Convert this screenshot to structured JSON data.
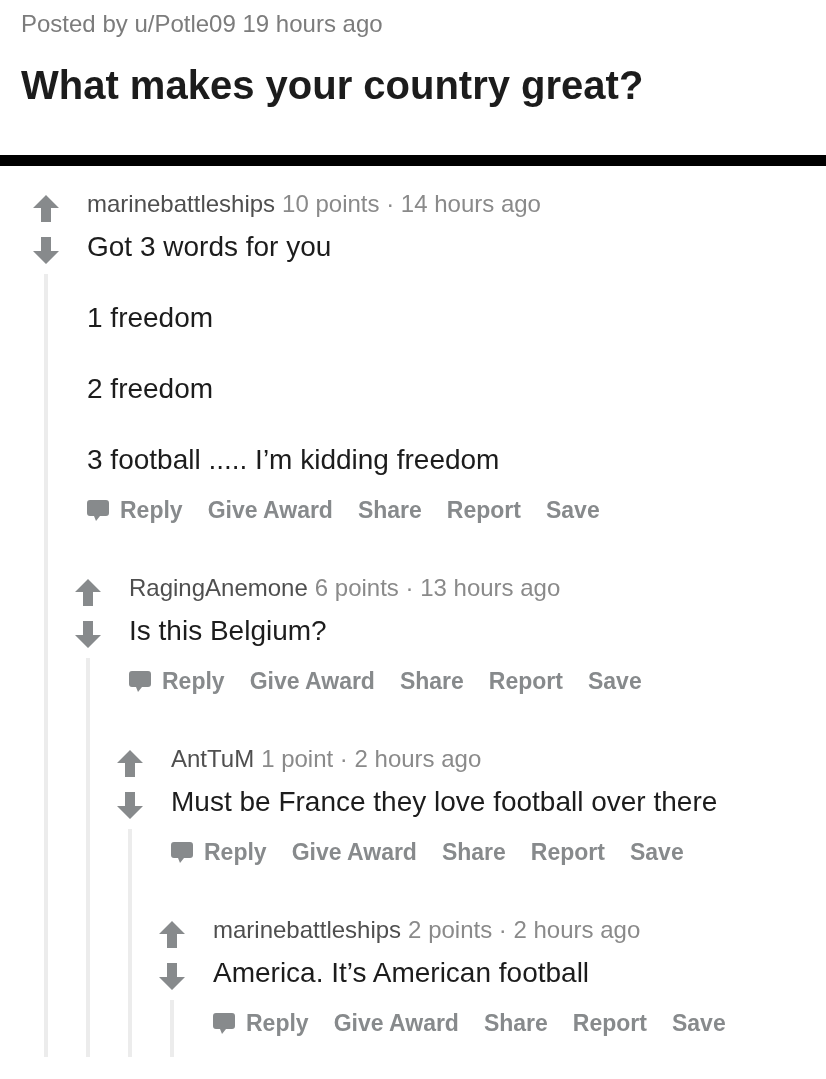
{
  "post": {
    "meta": "Posted by u/Potle09 19 hours ago",
    "title": "What makes your country great?"
  },
  "comments": [
    {
      "author": "marinebattleships",
      "meta": "10 points · 14 hours ago",
      "paragraphs": [
        "Got 3 words for you",
        "1 freedom",
        "2 freedom",
        "3 football ..... I’m kidding freedom"
      ],
      "actions": [
        {
          "kind": "reply",
          "label": "Reply"
        },
        {
          "kind": "award",
          "label": "Give Award"
        },
        {
          "kind": "share",
          "label": "Share"
        },
        {
          "kind": "report",
          "label": "Report"
        },
        {
          "kind": "save",
          "label": "Save"
        }
      ],
      "children": [
        {
          "author": "RagingAnemone",
          "meta": "6 points · 13 hours ago",
          "paragraphs": [
            "Is this Belgium?"
          ],
          "actions": [
            {
              "kind": "reply",
              "label": "Reply"
            },
            {
              "kind": "award",
              "label": "Give Award"
            },
            {
              "kind": "share",
              "label": "Share"
            },
            {
              "kind": "report",
              "label": "Report"
            },
            {
              "kind": "save",
              "label": "Save"
            }
          ],
          "children": [
            {
              "author": "AntTuM",
              "meta": "1 point · 2 hours ago",
              "paragraphs": [
                "Must be France they love football over there"
              ],
              "actions": [
                {
                  "kind": "reply",
                  "label": "Reply"
                },
                {
                  "kind": "award",
                  "label": "Give Award"
                },
                {
                  "kind": "share",
                  "label": "Share"
                },
                {
                  "kind": "report",
                  "label": "Report"
                },
                {
                  "kind": "save",
                  "label": "Save"
                }
              ],
              "children": [
                {
                  "author": "marinebattleships",
                  "meta": "2 points · 2 hours ago",
                  "paragraphs": [
                    "America. It’s American football"
                  ],
                  "actions": [
                    {
                      "kind": "reply",
                      "label": "Reply"
                    },
                    {
                      "kind": "award",
                      "label": "Give Award"
                    },
                    {
                      "kind": "share",
                      "label": "Share"
                    },
                    {
                      "kind": "report",
                      "label": "Report"
                    },
                    {
                      "kind": "save",
                      "label": "Save"
                    }
                  ]
                }
              ]
            }
          ]
        }
      ]
    }
  ]
}
